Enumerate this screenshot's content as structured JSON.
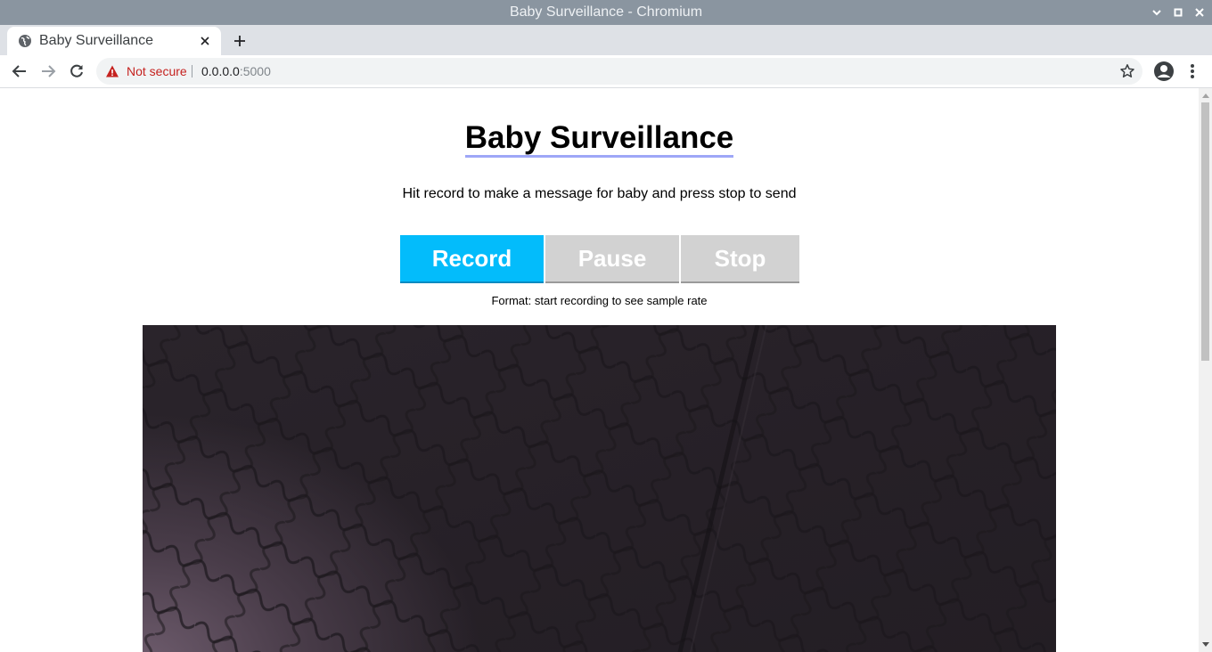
{
  "window": {
    "title": "Baby Surveillance - Chromium"
  },
  "tab": {
    "title": "Baby Surveillance",
    "icon": "globe-icon"
  },
  "omnibox": {
    "security_label": "Not secure",
    "host": "0.0.0.0",
    "port": ":5000"
  },
  "page": {
    "title": "Baby Surveillance",
    "instructions": "Hit record to make a message for baby and press stop to send",
    "buttons": {
      "record": "Record",
      "pause": "Pause",
      "stop": "Stop"
    },
    "format_text": "Format: start recording to see sample rate"
  },
  "colors": {
    "record_button": "#03bcfb",
    "disabled_button": "#d2d2d2",
    "title_underline": "#9ea7f7",
    "warning": "#c5221f"
  }
}
